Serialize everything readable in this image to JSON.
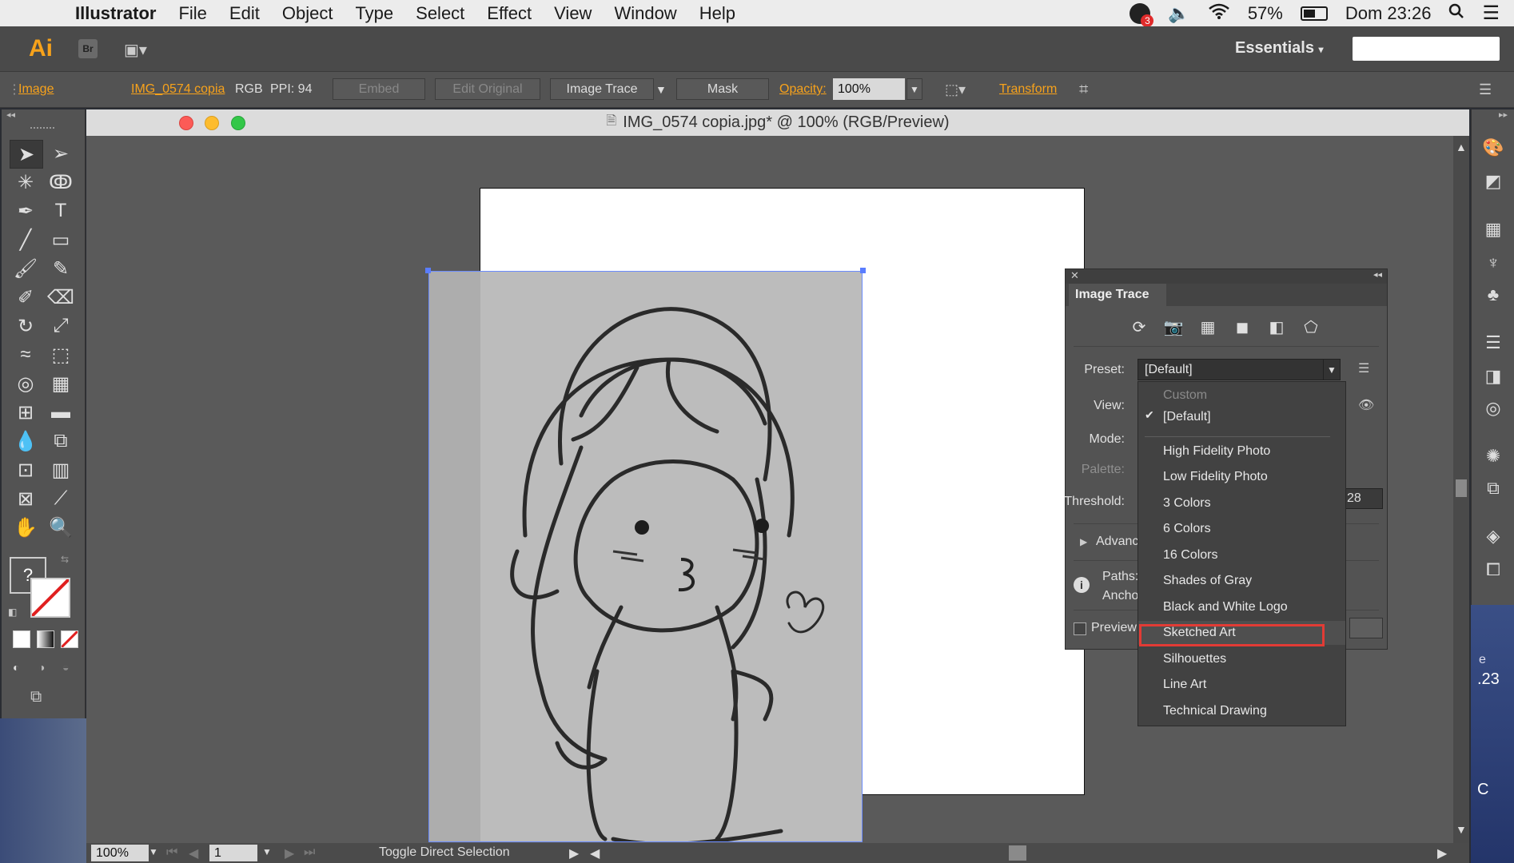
{
  "menubar": {
    "app": "Illustrator",
    "items": [
      "File",
      "Edit",
      "Object",
      "Type",
      "Select",
      "Effect",
      "View",
      "Window",
      "Help"
    ],
    "notification_count": "3",
    "battery": "57%",
    "clock": "Dom 23:26"
  },
  "appbar": {
    "logo": "Ai",
    "bridge": "Br",
    "workspace": "Essentials"
  },
  "controlbar": {
    "type_label": "Image",
    "file_link": "IMG_0574 copia",
    "color_mode": "RGB",
    "ppi": "PPI: 94",
    "embed": "Embed",
    "edit_original": "Edit Original",
    "image_trace": "Image Trace",
    "mask": "Mask",
    "opacity_label": "Opacity:",
    "opacity_value": "100%",
    "transform": "Transform"
  },
  "document": {
    "title": "IMG_0574 copia.jpg* @ 100% (RGB/Preview)"
  },
  "status": {
    "zoom": "100%",
    "page": "1",
    "text": "Toggle Direct Selection"
  },
  "trace_panel": {
    "title": "Image Trace",
    "preset_label": "Preset:",
    "preset_value": "[Default]",
    "view_label": "View:",
    "mode_label": "Mode:",
    "palette_label": "Palette:",
    "threshold_label": "Threshold:",
    "threshold_value_partial": "28",
    "advanced_label": "Advanc",
    "paths_label": "Paths:",
    "anchors_label": "Ancho",
    "preview_label": "Preview"
  },
  "preset_menu": {
    "items": [
      {
        "label": "Custom",
        "state": "disabled"
      },
      {
        "label": "[Default]",
        "state": "checked"
      },
      {
        "label": "High Fidelity Photo",
        "state": "normal"
      },
      {
        "label": "Low Fidelity Photo",
        "state": "normal"
      },
      {
        "label": "3 Colors",
        "state": "normal"
      },
      {
        "label": "6 Colors",
        "state": "normal"
      },
      {
        "label": "16 Colors",
        "state": "normal"
      },
      {
        "label": "Shades of Gray",
        "state": "normal"
      },
      {
        "label": "Black and White Logo",
        "state": "normal"
      },
      {
        "label": "Sketched Art",
        "state": "highlighted"
      },
      {
        "label": "Silhouettes",
        "state": "normal"
      },
      {
        "label": "Line Art",
        "state": "normal"
      },
      {
        "label": "Technical Drawing",
        "state": "normal"
      }
    ]
  },
  "desktop": {
    "right_fragment_1": "e",
    "right_fragment_2": ".23",
    "right_fragment_3": "C"
  }
}
